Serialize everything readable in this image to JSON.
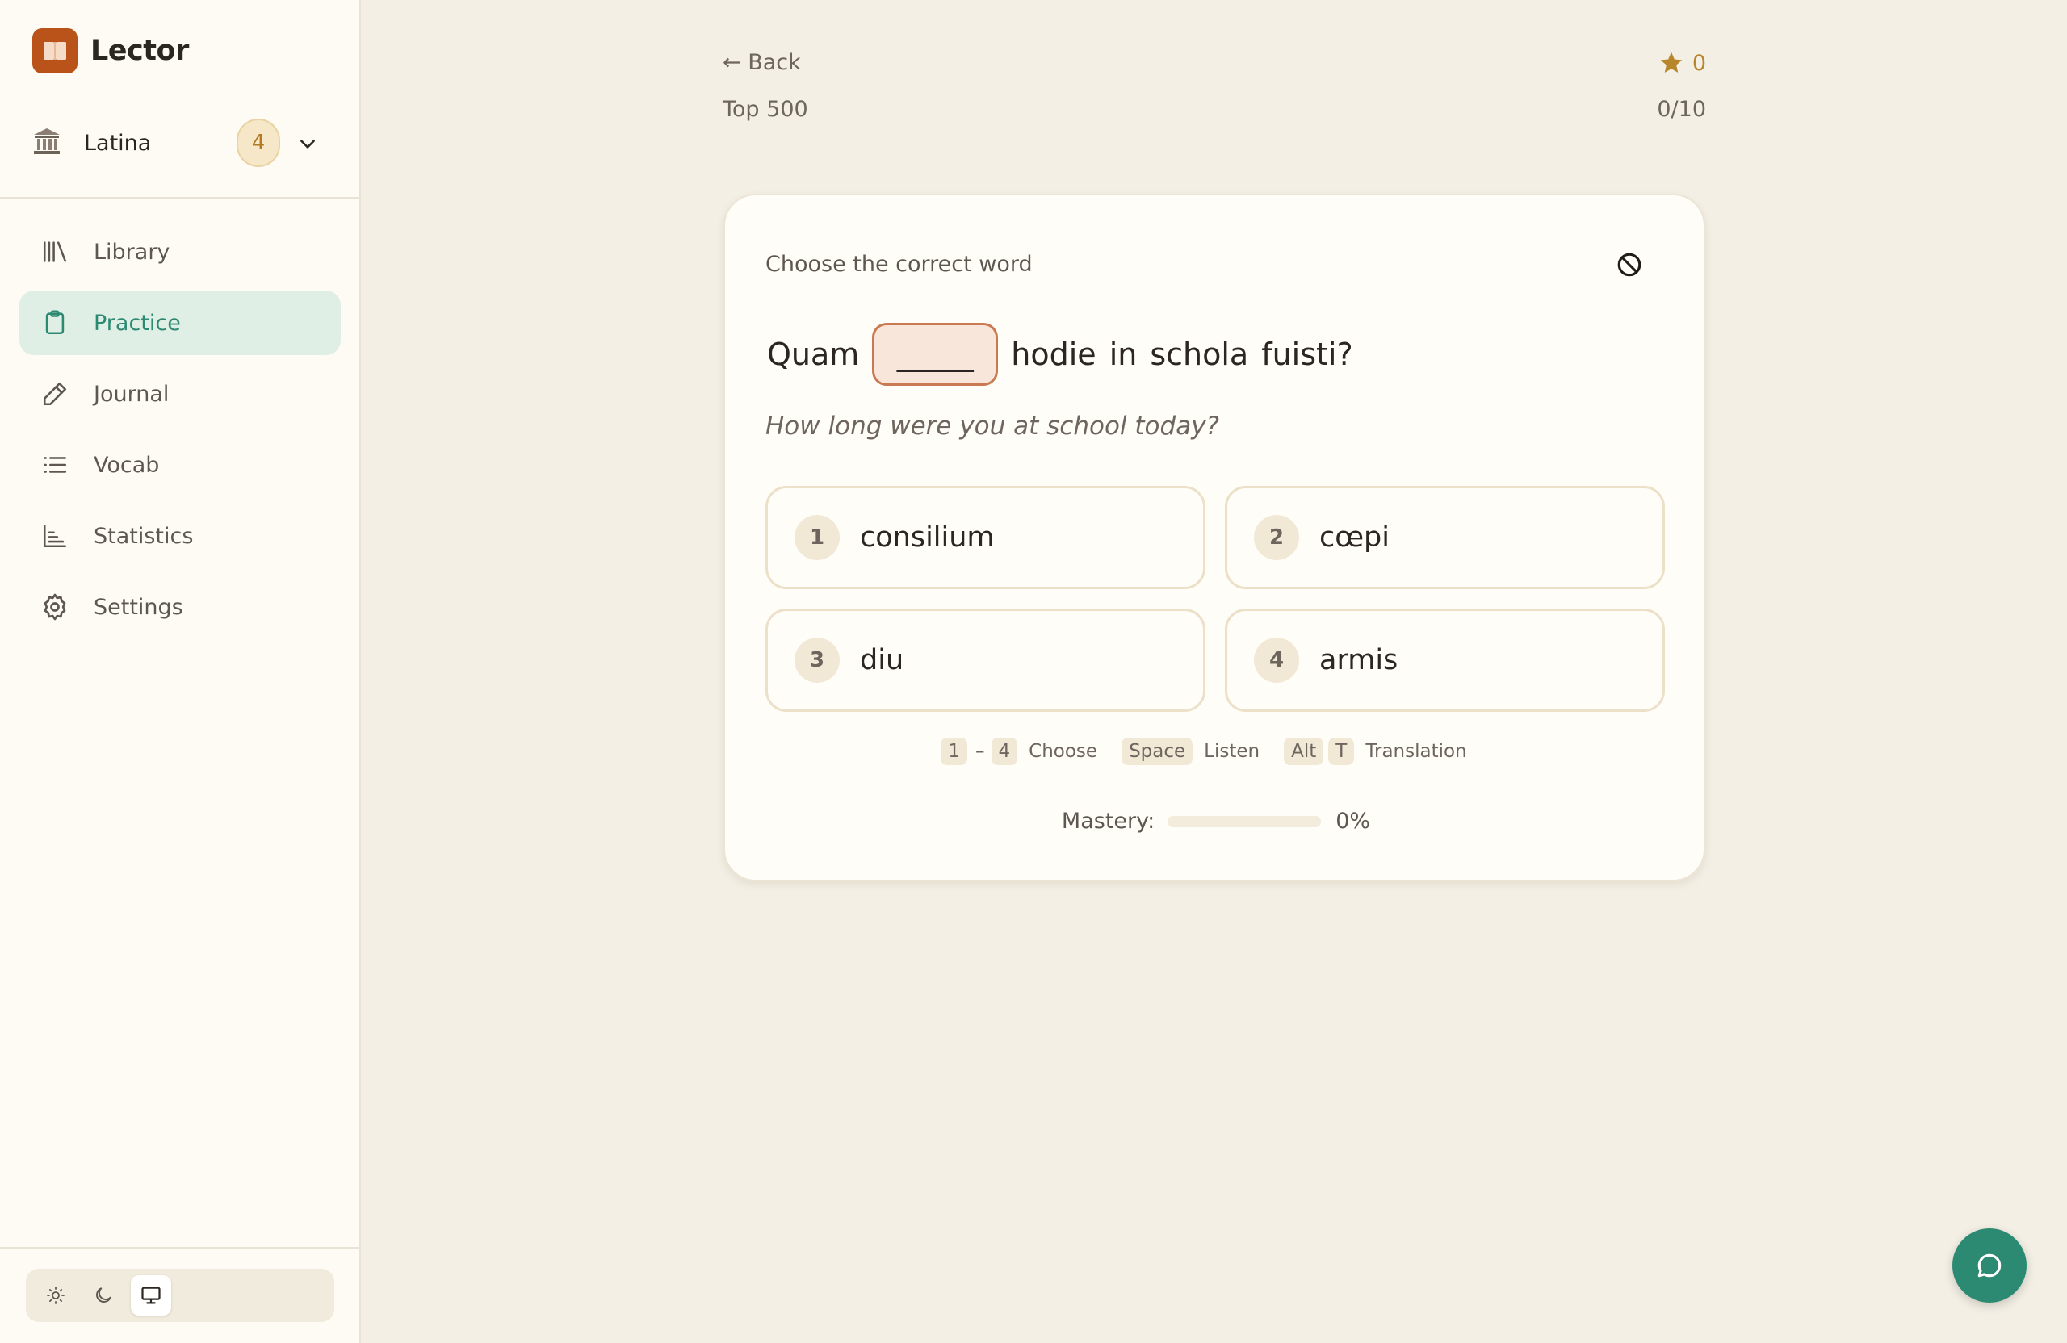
{
  "app": {
    "name": "Lector"
  },
  "language": {
    "name": "Latina",
    "badge": "4"
  },
  "nav": {
    "items": [
      {
        "label": "Library",
        "icon": "library-icon"
      },
      {
        "label": "Practice",
        "icon": "clipboard-icon",
        "active": true
      },
      {
        "label": "Journal",
        "icon": "pencil-icon"
      },
      {
        "label": "Vocab",
        "icon": "list-icon"
      },
      {
        "label": "Statistics",
        "icon": "bar-chart-icon"
      },
      {
        "label": "Settings",
        "icon": "gear-icon"
      }
    ]
  },
  "theme": {
    "options": [
      "light",
      "dark",
      "system"
    ],
    "selected": "system"
  },
  "header": {
    "back": "← Back",
    "deck": "Top 500",
    "stars": "0",
    "progress": "0/10"
  },
  "exercise": {
    "prompt": "Choose the correct word",
    "sentence_before": "Quam",
    "blank": "_____",
    "sentence_after": [
      "hodie",
      "in",
      "schola",
      "fuisti?"
    ],
    "translation": "How long were you at school today?",
    "options": [
      {
        "num": "1",
        "text": "consilium"
      },
      {
        "num": "2",
        "text": "cœpi"
      },
      {
        "num": "3",
        "text": "diu"
      },
      {
        "num": "4",
        "text": "armis"
      }
    ]
  },
  "hints": {
    "range_start": "1",
    "range_dash": "–",
    "range_end": "4",
    "choose": "Choose",
    "space_key": "Space",
    "listen": "Listen",
    "alt_key": "Alt",
    "t_key": "T",
    "translation": "Translation"
  },
  "mastery": {
    "label": "Mastery:",
    "value": "0%",
    "fraction": 0
  },
  "colors": {
    "accent": "#2d8a72",
    "brand": "#b9531a",
    "background": "#f3efe5",
    "star": "#b8862a"
  }
}
